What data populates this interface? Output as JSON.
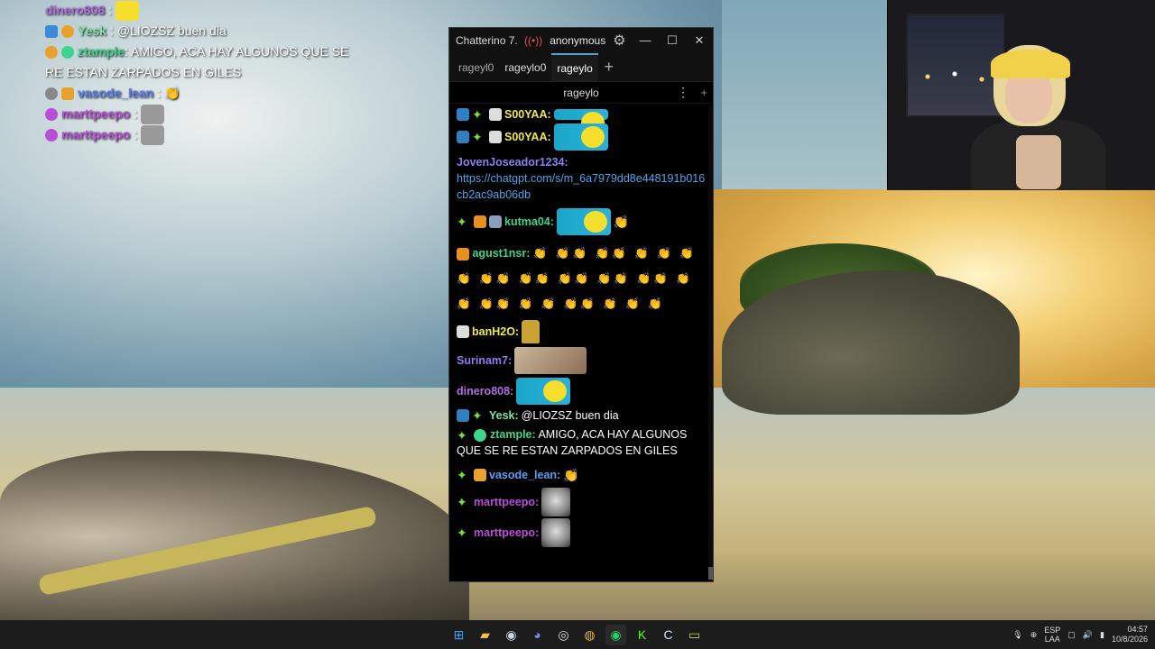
{
  "overlay": {
    "lines": [
      {
        "user": "dinero808",
        "text": "",
        "user_color": "#b36ce0"
      },
      {
        "user": "Yesk",
        "text": "@LIOZSZ buen dia",
        "user_color": "#7fe3a6"
      },
      {
        "user": "ztample",
        "text": "AMIGO, ACA HAY ALGUNOS QUE SE RE ESTAN ZARPADOS EN GILES",
        "user_color": "#3fd48c"
      },
      {
        "user": "vasode_lean",
        "text": "",
        "user_color": "#5e7df0"
      },
      {
        "user": "marttpeepo",
        "text": "",
        "user_color": "#b84fd6"
      },
      {
        "user": "marttpeepo",
        "text": "",
        "user_color": "#b84fd6"
      }
    ]
  },
  "window": {
    "title": "Chatterino 7.",
    "live_icon": "broadcast-icon",
    "account": "anonymous",
    "minimize": "—",
    "maximize": "☐",
    "close": "✕"
  },
  "tabs": [
    {
      "label": "rageyl0",
      "active": false
    },
    {
      "label": "rageylo0",
      "active": false
    },
    {
      "label": "rageylo",
      "active": true
    }
  ],
  "channel": {
    "name": "rageylo"
  },
  "messages": {
    "m1_user": "S00YAA:",
    "m2_user": "S00YAA:",
    "m3_user": "JovenJoseador1234:",
    "m3_link": "https://chatgpt.com/s/m_6a7979dd8e448191b016cb2ac9ab06db",
    "m4_user": "kutma04:",
    "m5_user": "agust1nsr:",
    "m6_user": "banH2O:",
    "m7_user": "Surinam7:",
    "m8_user": "dinero808:",
    "m9_user": "Yesk:",
    "m9_text": "@LIOZSZ buen dia",
    "m10_user": "ztample:",
    "m10_text": "AMIGO, ACA HAY ALGUNOS QUE SE RE ESTAN ZARPADOS EN GILES",
    "m11_user": "vasode_lean:",
    "m12_user": "marttpeepo:",
    "m13_user": "marttpeepo:"
  },
  "taskbar": {
    "lang_top": "ESP",
    "lang_bottom": "LAA",
    "time": "04:57",
    "date": "10/8/2026"
  }
}
